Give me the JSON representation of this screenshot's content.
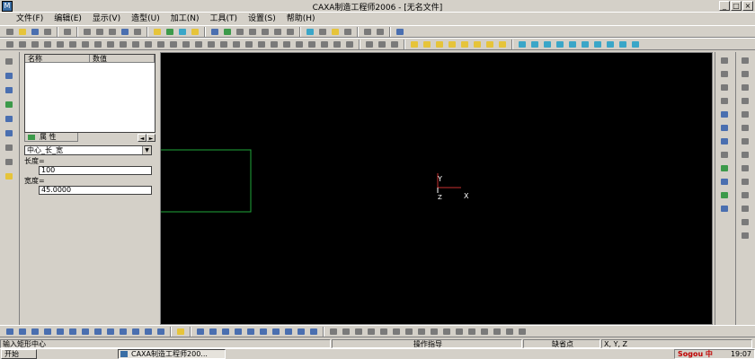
{
  "window": {
    "title": "CAXA制造工程师2006 - [无名文件]",
    "buttons": [
      "_",
      "□",
      "×"
    ]
  },
  "menu": [
    "文件(F)",
    "编辑(E)",
    "显示(V)",
    "造型(U)",
    "加工(N)",
    "工具(T)",
    "设置(S)",
    "帮助(H)"
  ],
  "properties": {
    "columns": [
      "名称",
      "数值"
    ],
    "tab_label": "属   性",
    "arrows": [
      "◄",
      "►"
    ]
  },
  "command": {
    "mode": "中心_长_宽",
    "mode_arrow": "▼",
    "length_label": "长度=",
    "length_value": "100",
    "width_label": "宽度=",
    "width_value": "45.0000"
  },
  "canvas": {
    "background": "#000000",
    "rect_color": "#1fa83a",
    "axis": {
      "x_label": "X",
      "y_label": "Y",
      "z_label": "Z"
    }
  },
  "status": {
    "prompt": "输入矩形中心",
    "hint": "操作指导",
    "snap": "缺省点",
    "coords": "X, Y, Z"
  },
  "taskbar": {
    "start": "开始",
    "app_button": "CAXA制造工程师200...",
    "ime": "Sogou 中",
    "clock": "19:07"
  }
}
